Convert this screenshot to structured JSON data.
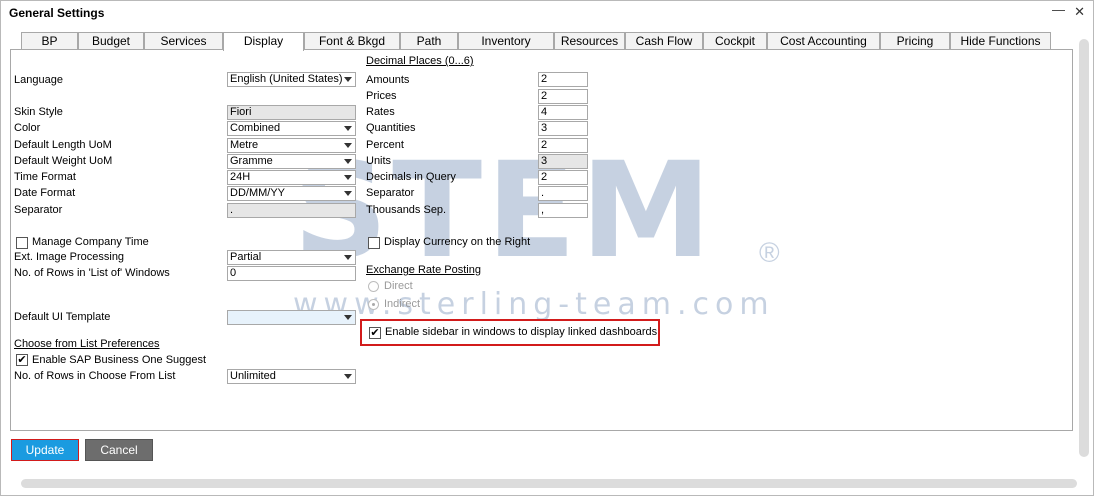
{
  "window": {
    "title": "General Settings"
  },
  "tabs": [
    {
      "label": "BP"
    },
    {
      "label": "Budget"
    },
    {
      "label": "Services"
    },
    {
      "label": "Display"
    },
    {
      "label": "Font & Bkgd"
    },
    {
      "label": "Path"
    },
    {
      "label": "Inventory"
    },
    {
      "label": "Resources"
    },
    {
      "label": "Cash Flow"
    },
    {
      "label": "Cockpit"
    },
    {
      "label": "Cost Accounting"
    },
    {
      "label": "Pricing"
    },
    {
      "label": "Hide Functions"
    }
  ],
  "active_tab": "Display",
  "left": {
    "language": {
      "label": "Language",
      "value": "English (United States)"
    },
    "skin_style": {
      "label": "Skin Style",
      "value": "Fiori"
    },
    "color": {
      "label": "Color",
      "value": "Combined"
    },
    "default_length_uom": {
      "label": "Default Length UoM",
      "value": "Metre"
    },
    "default_weight_uom": {
      "label": "Default Weight UoM",
      "value": "Gramme"
    },
    "time_format": {
      "label": "Time Format",
      "value": "24H"
    },
    "date_format": {
      "label": "Date Format",
      "value": "DD/MM/YY"
    },
    "separator": {
      "label": "Separator",
      "value": "."
    },
    "manage_company_time": {
      "label": "Manage Company Time",
      "checked": false
    },
    "ext_image_processing": {
      "label": "Ext. Image Processing",
      "value": "Partial"
    },
    "rows_list_of": {
      "label": "No. of Rows in 'List of' Windows",
      "value": "0"
    },
    "default_ui_template": {
      "label": "Default UI Template",
      "value": ""
    },
    "choose_from_list": {
      "heading": "Choose from List Preferences"
    },
    "enable_suggest": {
      "label": "Enable SAP Business One Suggest",
      "checked": true
    },
    "rows_choose_from": {
      "label": "No. of Rows in Choose From List",
      "value": "Unlimited"
    }
  },
  "right": {
    "decimal_places_heading": "Decimal Places (0...6)",
    "amounts": {
      "label": "Amounts",
      "value": "2"
    },
    "prices": {
      "label": "Prices",
      "value": "2"
    },
    "rates": {
      "label": "Rates",
      "value": "4"
    },
    "quantities": {
      "label": "Quantities",
      "value": "3"
    },
    "percent": {
      "label": "Percent",
      "value": "2"
    },
    "units": {
      "label": "Units",
      "value": "3"
    },
    "decimals_in_query": {
      "label": "Decimals in Query",
      "value": "2"
    },
    "separator": {
      "label": "Separator",
      "value": "."
    },
    "thousands_sep": {
      "label": "Thousands Sep.",
      "value": ","
    },
    "display_currency_right": {
      "label": "Display Currency on the Right",
      "checked": false
    },
    "exchange_rate_posting": {
      "heading": "Exchange Rate Posting"
    },
    "direct": {
      "label": "Direct"
    },
    "indirect": {
      "label": "Indirect"
    },
    "enable_sidebar": {
      "label": "Enable sidebar in windows to display linked dashboards",
      "checked": true
    }
  },
  "buttons": {
    "update": "Update",
    "cancel": "Cancel"
  },
  "watermark": {
    "logo": "STEM",
    "url": "www.sterling-team.com"
  },
  "colors": {
    "highlight": "#d21b1b",
    "primary_button": "#1a9be0",
    "watermark": "#1f4c8a"
  }
}
